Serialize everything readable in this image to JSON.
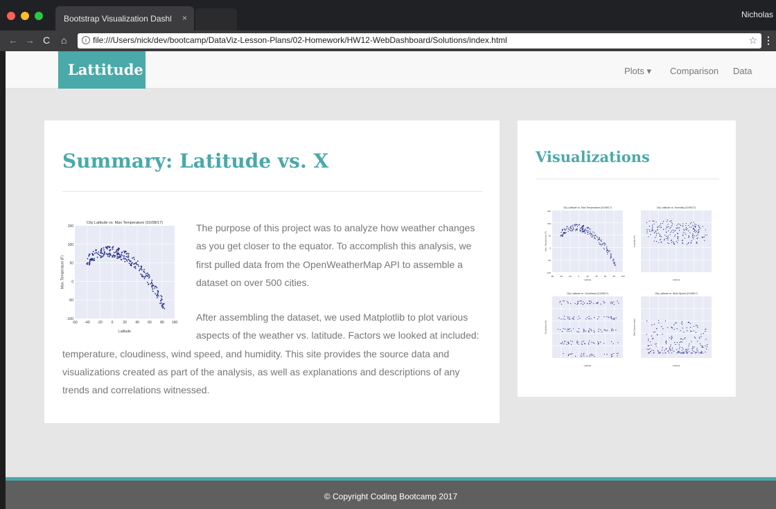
{
  "browser": {
    "tab_title": "Bootstrap Visualization Dashboard",
    "tab_close": "×",
    "profile": "Nicholas",
    "url": "file:///Users/nick/dev/bootcamp/DataViz-Lesson-Plans/02-Homework/HW12-WebDashboard/Solutions/index.html",
    "back_glyph": "←",
    "forward_glyph": "→",
    "reload_glyph": "C",
    "home_glyph": "⌂",
    "info_glyph": "i",
    "star_glyph": "☆",
    "menu_glyph": "⋮",
    "traffic_light_colors": [
      "#fe5f57",
      "#febc2e",
      "#28c840"
    ]
  },
  "navbar": {
    "brand": "Lattitude",
    "links": [
      "Plots ▾",
      "Comparison",
      "Data"
    ]
  },
  "summary": {
    "title": "Summary: Latitude vs. X",
    "paragraph_1": "The purpose of this project was to analyze how weather changes as you get closer to the equator. To accomplish this analysis, we first pulled data from the OpenWeatherMap API to assemble a dataset on over 500 cities.",
    "paragraph_2": "After assembling the dataset, we used Matplotlib to plot various aspects of the weather vs. latitude. Factors we looked at included: temperature, cloudiness, wind speed, and humidity. This site provides the source data and visualizations created as part of the analysis, as well as explanations and descriptions of any trends and correlations witnessed."
  },
  "visualizations": {
    "title": "Visualizations"
  },
  "footer": {
    "text": "© Copyright Coding Bootcamp 2017"
  },
  "colors": {
    "accent": "#4aa9a9",
    "plot_background": "#e8eaf6",
    "marker": "#1a237e"
  },
  "chart_data": [
    {
      "type": "scatter",
      "title": "City Latitude vs. Max Temperature (01/08/17)",
      "xlabel": "Latitude",
      "ylabel": "Max. Temperature (F)",
      "xlim": [
        -60,
        100
      ],
      "ylim": [
        -100,
        150
      ],
      "xticks": [
        -60,
        -40,
        -20,
        0,
        20,
        40,
        60,
        80,
        100
      ],
      "yticks": [
        -100,
        -50,
        0,
        50,
        100,
        150
      ],
      "grid": true
    },
    {
      "type": "scatter",
      "title": "City Latitude vs. Humidity (01/08/17)",
      "xlabel": "Latitude",
      "ylabel": "Humidity (%)",
      "xlim": [
        -60,
        100
      ],
      "ylim": [
        0,
        120
      ],
      "grid": true
    },
    {
      "type": "scatter",
      "title": "City Latitude vs. Cloudiness (01/08/17)",
      "xlabel": "Latitude",
      "ylabel": "Cloudiness (%)",
      "xlim": [
        -60,
        100
      ],
      "ylim": [
        0,
        100
      ],
      "grid": true
    },
    {
      "type": "scatter",
      "title": "City Latitude vs. Wind Speed (01/08/17)",
      "xlabel": "Latitude",
      "ylabel": "Wind Speed (mph)",
      "xlim": [
        -60,
        100
      ],
      "ylim": [
        0,
        30
      ],
      "grid": true
    }
  ]
}
